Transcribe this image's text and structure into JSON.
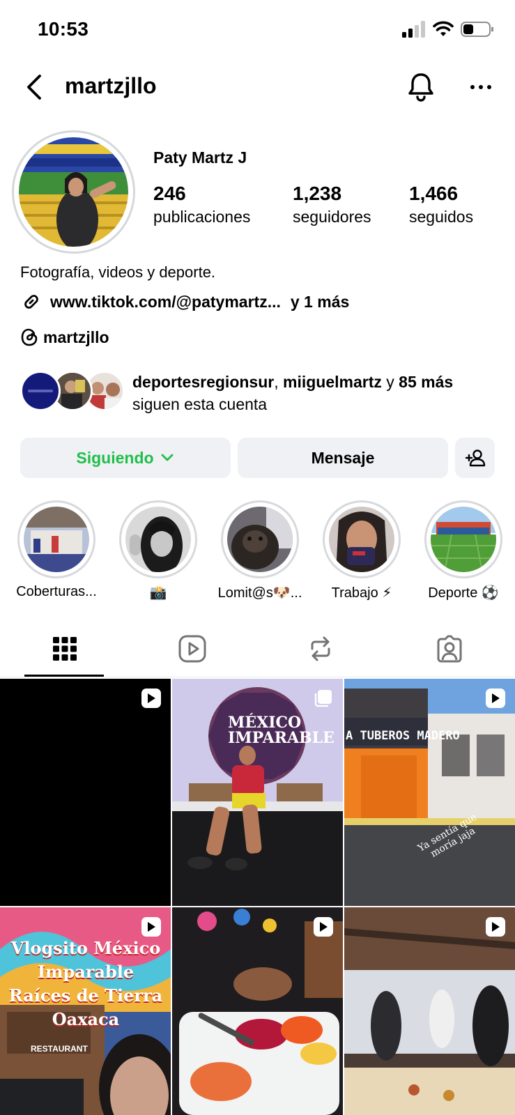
{
  "status_bar": {
    "time": "10:53"
  },
  "nav": {
    "username": "martzjllo"
  },
  "profile": {
    "display_name": "Paty Martz J",
    "stats": [
      {
        "value": "246",
        "label": "publicaciones"
      },
      {
        "value": "1,238",
        "label": "seguidores"
      },
      {
        "value": "1,466",
        "label": "seguidos"
      }
    ],
    "bio": "Fotografía, videos y deporte.",
    "link": "www.tiktok.com/@patymartz...",
    "link_more": "y 1 más",
    "threads_handle": "martzjllo",
    "followed_by": {
      "user1": "deportesregionsur",
      "separator": ",",
      "user2": "miiguelmartz",
      "and": "y",
      "others": "85 más",
      "suffix": "siguen esta cuenta"
    }
  },
  "buttons": {
    "following": "Siguiendo",
    "message": "Mensaje"
  },
  "highlights": [
    {
      "label": "Coberturas..."
    },
    {
      "label": "📸"
    },
    {
      "label": "Lomit@s🐶..."
    },
    {
      "label": "Trabajo ⚡"
    },
    {
      "label": "Deporte ⚽"
    }
  ],
  "posts": [
    {
      "type": "reel",
      "overlay": ""
    },
    {
      "type": "carousel",
      "overlay": "MÉXICO IMPARABLE"
    },
    {
      "type": "reel",
      "overlay": "Ya sentía que moría jaja"
    },
    {
      "type": "reel",
      "overlay": "Vlogsito México Imparable Raíces de Tierra Oaxaca"
    },
    {
      "type": "reel",
      "overlay": ""
    },
    {
      "type": "reel",
      "overlay": ""
    }
  ],
  "signboards": {
    "post3_sign": "A TUBEROS MADERO",
    "post4_sign": "RESTAURANT"
  },
  "colors": {
    "following_green": "#1fbf4a",
    "button_bg": "#eff1f4",
    "story_ring": "#d7d9dd"
  }
}
